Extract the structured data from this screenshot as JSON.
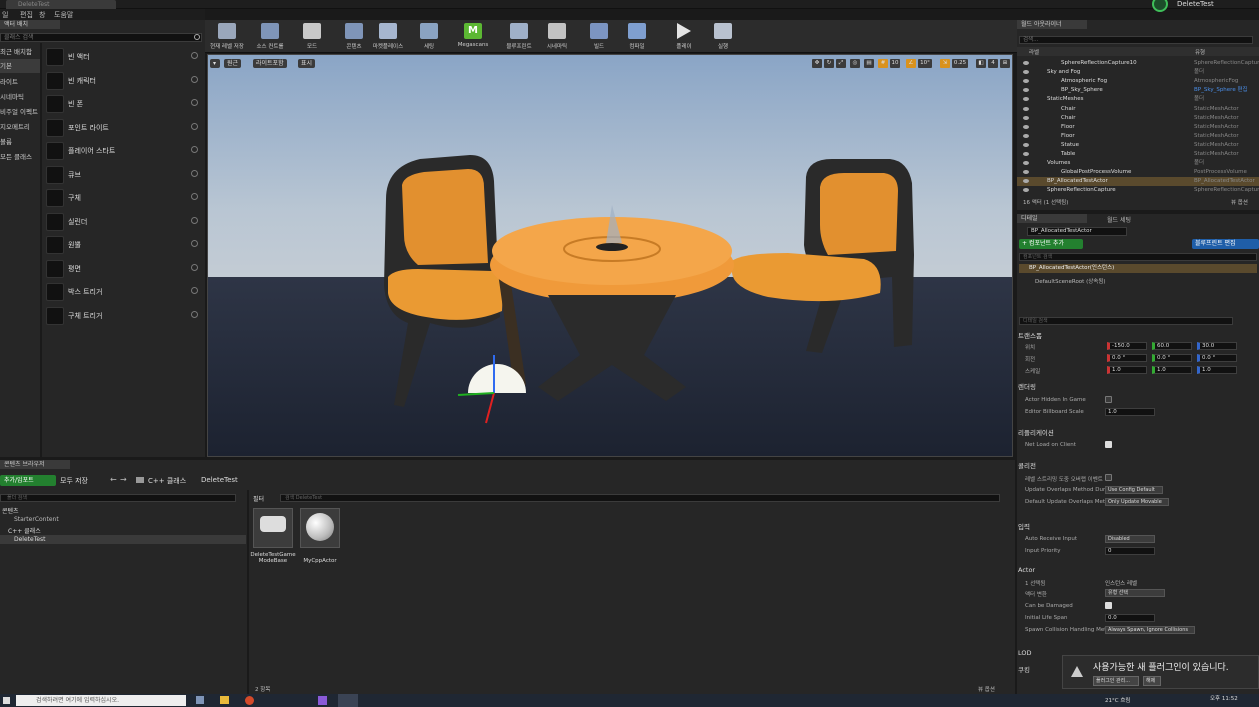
{
  "window": {
    "tab_title": "DeleteTest",
    "user_label": "DeleteTest"
  },
  "menu": [
    "일",
    "편집",
    "창",
    "도움말"
  ],
  "modes": {
    "tab_label": "모드",
    "placement_tab": "액터 배치",
    "search_placeholder": "클래스 검색",
    "categories": [
      "최근 배치함",
      "기본",
      "라이트",
      "시네마틱",
      "비주얼 이펙트",
      "지오메트리",
      "볼륨",
      "모든 클래스"
    ],
    "items": [
      "빈 액터",
      "빈 캐릭터",
      "빈 폰",
      "포인트 라이트",
      "플레이어 스타트",
      "큐브",
      "구체",
      "실린더",
      "원뿔",
      "평면",
      "박스 트리거",
      "구체 트리거"
    ]
  },
  "toolbar": {
    "buttons": [
      "현재 레벨 저장",
      "소스 컨트롤",
      "모드",
      "콘텐츠",
      "마켓플레이스",
      "세팅",
      "Megascans",
      "블루프린트",
      "시네마틱",
      "빌드",
      "컴파일",
      "플레이",
      "실행"
    ]
  },
  "viewport": {
    "view_mode_left": [
      "원근",
      "라이트포함",
      "표시"
    ],
    "grid_snap": "10",
    "rot_snap": "10°",
    "scale_snap": "0.25",
    "cam_speed": "4"
  },
  "outliner": {
    "tab": "월드 아웃라이너",
    "search_placeholder": "검색...",
    "col_label": "라벨",
    "col_type": "유형",
    "rows": [
      {
        "name": "SphereReflectionCapture10",
        "type": "SphereReflectionCapture",
        "indent": 2
      },
      {
        "name": "Sky and Fog",
        "type": "폴더",
        "indent": 1
      },
      {
        "name": "Atmospheric Fog",
        "type": "AtmosphericFog",
        "indent": 2
      },
      {
        "name": "BP_Sky_Sphere",
        "type": "BP_Sky_Sphere 편집",
        "indent": 2
      },
      {
        "name": "StaticMeshes",
        "type": "폴더",
        "indent": 1
      },
      {
        "name": "Chair",
        "type": "StaticMeshActor",
        "indent": 2
      },
      {
        "name": "Chair",
        "type": "StaticMeshActor",
        "indent": 2
      },
      {
        "name": "Floor",
        "type": "StaticMeshActor",
        "indent": 2
      },
      {
        "name": "Floor",
        "type": "StaticMeshActor",
        "indent": 2
      },
      {
        "name": "Statue",
        "type": "StaticMeshActor",
        "indent": 2
      },
      {
        "name": "Table",
        "type": "StaticMeshActor",
        "indent": 2
      },
      {
        "name": "Volumes",
        "type": "폴더",
        "indent": 1
      },
      {
        "name": "GlobalPostProcessVolume",
        "type": "PostProcessVolume",
        "indent": 2
      },
      {
        "name": "BP_AllocatedTestActor",
        "type": "BP_AllocatedTestActor",
        "indent": 1
      },
      {
        "name": "SphereReflectionCapture",
        "type": "SphereReflectionCapture",
        "indent": 1
      }
    ],
    "footer": "16 액터 (1 선택됨)",
    "view_options": "뷰 옵션"
  },
  "details": {
    "tab_details": "디테일",
    "tab_world": "월드 세팅",
    "actor_name": "BP_AllocatedTestActor",
    "add_component": "+ 컴포넌트 추가",
    "edit_blueprint": "블루프린트 편집",
    "component_search": "컴포넌트 검색",
    "root_label": "BP_AllocatedTestActor(인스턴스)",
    "scene_root": "DefaultSceneRoot (상속됨)",
    "detail_search": "디테일 검색",
    "transform_hdr": "트랜스폼",
    "location_label": "위치",
    "rotation_label": "회전",
    "scale_label": "스케일",
    "location": [
      "-150.0",
      "60.0",
      "30.0"
    ],
    "rotation": [
      "0.0 °",
      "0.0 °",
      "0.0 °"
    ],
    "scale": [
      "1.0",
      "1.0",
      "1.0"
    ],
    "render_hdr": "렌더링",
    "hidden_label": "Actor Hidden In Game",
    "billboard_label": "Editor Billboard Scale",
    "billboard_value": "1.0",
    "replication_hdr": "리플리케이션",
    "net_load_label": "Net Load on Client",
    "collision_hdr": "콜리전",
    "gen_overlap_label": "레벨 스트리밍 도중 오버랩 이벤트",
    "update_overlap_label": "Update Overlaps Method During",
    "update_overlap_value": "Use Config Default",
    "default_overlap_label": "Default Update Overlaps Metho",
    "default_overlap_value": "Only Update Movable",
    "input_hdr": "입력",
    "auto_input_label": "Auto Receive Input",
    "auto_input_value": "Disabled",
    "input_priority_label": "Input Priority",
    "input_priority_value": "0",
    "actor_hdr": "Actor",
    "selected_label": "1 선택됨",
    "selected_value": "인스턴스 레벨",
    "convert_label": "액터 변환",
    "convert_value": "유형 선택",
    "damage_label": "Can be Damaged",
    "lifespan_label": "Initial Life Span",
    "lifespan_value": "0.0",
    "spawn_label": "Spawn Collision Handling Meth",
    "spawn_value": "Always Spawn, Ignore Collisions",
    "lod_hdr": "LOD",
    "cooking_hdr": "쿠킹"
  },
  "content_browser": {
    "tab": "콘텐츠 브라우저",
    "add_import": "추가/임포트",
    "save_all": "모두 저장",
    "path": [
      "C++ 클래스",
      "DeleteTest"
    ],
    "folder_search": "폴더 검색",
    "filter": "필터",
    "asset_search": "검색 DeleteTest",
    "tree": [
      "콘텐츠",
      "StarterContent",
      "C++ 클래스",
      "DeleteTest"
    ],
    "assets": [
      "DeleteTestGame ModeBase",
      "MyCppActor"
    ],
    "item_count": "2 항목",
    "view_options": "뷰 옵션"
  },
  "notification": {
    "text": "사용가능한 새 플러그인이 있습니다.",
    "manage": "플러그인 관리...",
    "dismiss": "해제"
  },
  "taskbar": {
    "search": "검색하려면 여기에 입력하십시오.",
    "weather": "21°C 흐림",
    "time": "오후 11:52"
  }
}
